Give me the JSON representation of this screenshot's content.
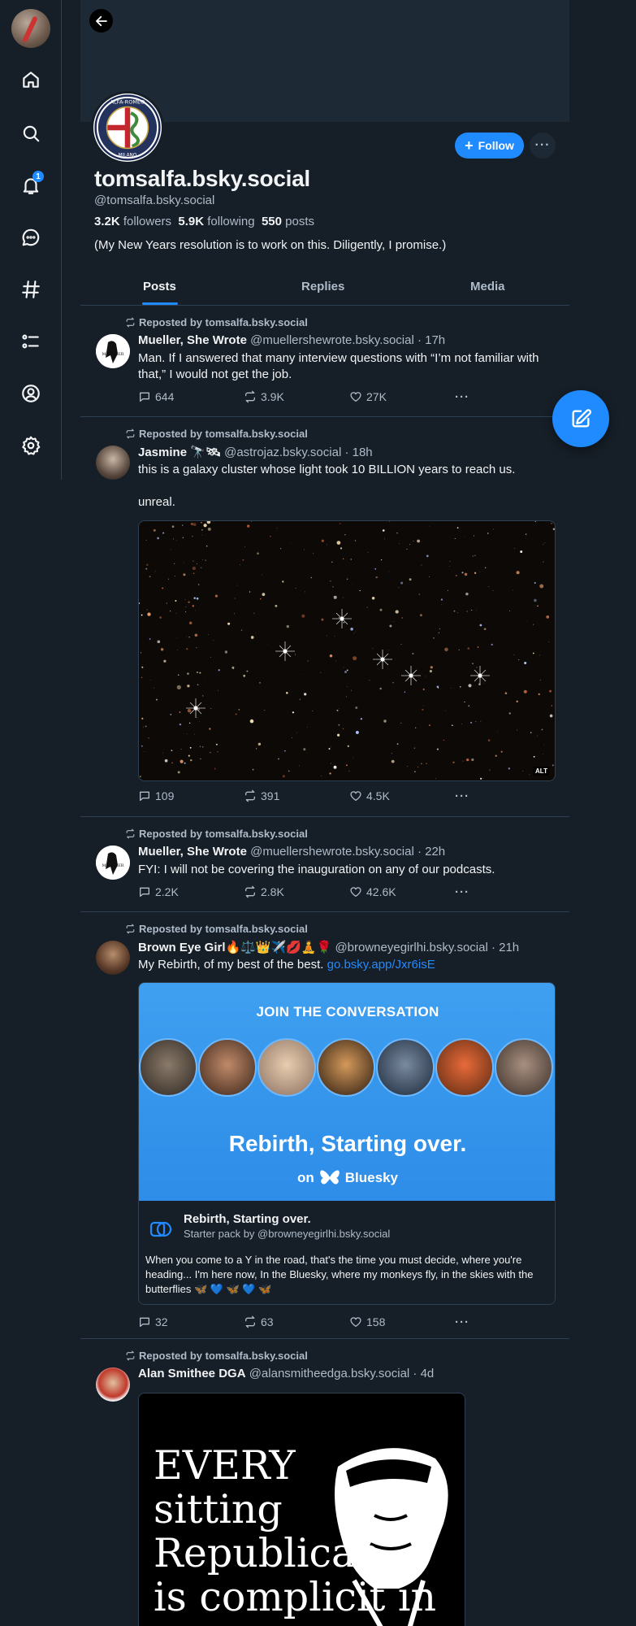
{
  "rail": {
    "notification_count": "1"
  },
  "profile": {
    "display_name": "tomsalfa.bsky.social",
    "handle": "@tomsalfa.bsky.social",
    "followers_count": "3.2K",
    "followers_label": "followers",
    "following_count": "5.9K",
    "following_label": "following",
    "posts_count": "550",
    "posts_label": "posts",
    "bio": "(My New Years resolution is to work on this. Diligently, I promise.)",
    "follow_label": "Follow",
    "more_label": "···"
  },
  "tabs": [
    "Posts",
    "Replies",
    "Media"
  ],
  "posts": [
    {
      "repost_by": "Reposted by tomsalfa.bsky.social",
      "author": "Mueller, She Wrote",
      "handle": "@muellershewrote.bsky.social · 17h",
      "text": "Man. If I answered that many interview questions with “I’m not familiar with that,” I would not get the job.",
      "replies": "644",
      "reposts": "3.9K",
      "likes": "27K"
    },
    {
      "repost_by": "Reposted by tomsalfa.bsky.social",
      "author": "Jasmine 🔭🛰",
      "handle": "@astrojaz.bsky.social · 18h",
      "text": "this is a galaxy cluster whose light took 10 BILLION years to reach us.",
      "text2": "unreal.",
      "alt": "ALT",
      "replies": "109",
      "reposts": "391",
      "likes": "4.5K"
    },
    {
      "repost_by": "Reposted by tomsalfa.bsky.social",
      "author": "Mueller, She Wrote",
      "handle": "@muellershewrote.bsky.social · 22h",
      "text": "FYI: I will not be covering the inauguration on any of our podcasts.",
      "replies": "2.2K",
      "reposts": "2.8K",
      "likes": "42.6K"
    },
    {
      "repost_by": "Reposted by tomsalfa.bsky.social",
      "author": "Brown Eye Girl🔥⚖️👑✈️💋🧘🌹",
      "handle": "@browneyegirlhi.bsky.social · 21h",
      "text": "My Rebirth, of my best of the best.",
      "link": "go.bsky.app/Jxr6isE",
      "embed": {
        "banner": "JOIN THE CONVERSATION",
        "headline": "Rebirth, Starting over.",
        "on_label": "on",
        "platform": "Bluesky",
        "title": "Rebirth, Starting over.",
        "subtitle": "Starter pack by @browneyegirlhi.bsky.social",
        "description": "When you come to a Y in the road, that's the time you must decide, where you're heading... I'm here now, In the Bluesky, where my monkeys fly, in the skies with the butterflies 🦋 💙 🦋 💙 🦋"
      },
      "replies": "32",
      "reposts": "63",
      "likes": "158"
    },
    {
      "repost_by": "Reposted by tomsalfa.bsky.social",
      "author": "Alan Smithee DGA",
      "handle": "@alansmitheedga.bsky.social · 4d",
      "image_text": [
        "EVERY",
        "sitting",
        "Republican",
        "is complicit in"
      ]
    }
  ],
  "colors": {
    "background": "#161e27",
    "accent": "#208bfe",
    "muted": "#aebbc9",
    "border": "#2e4052"
  }
}
